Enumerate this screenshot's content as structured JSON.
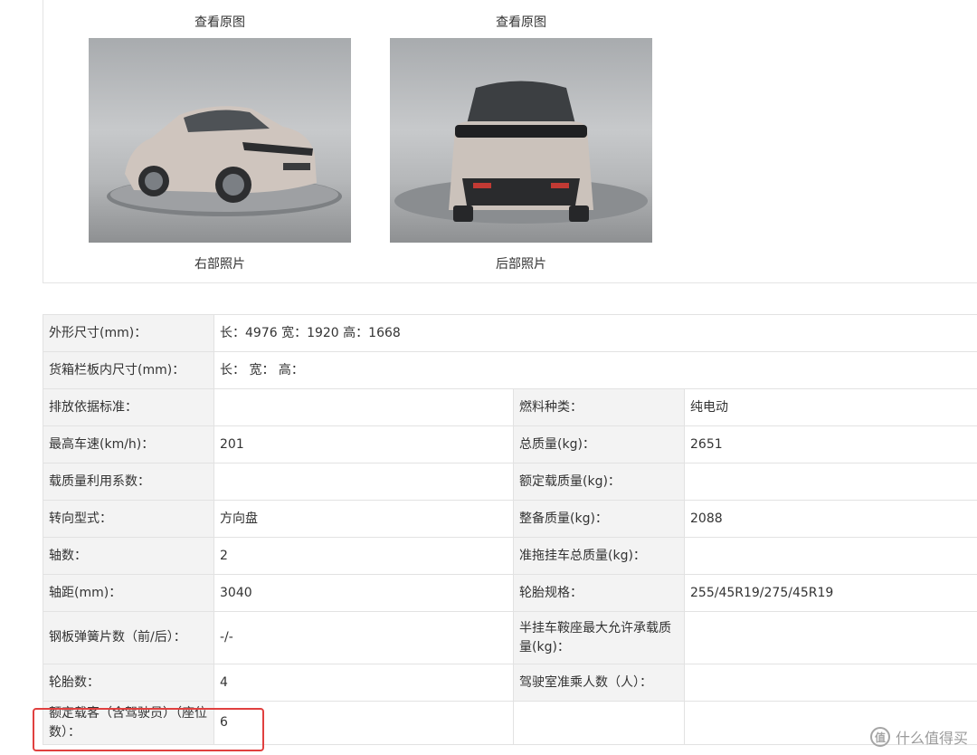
{
  "photos": [
    {
      "link": "查看原图",
      "caption": "右部照片",
      "icon": "car-front-right-photo"
    },
    {
      "link": "查看原图",
      "caption": "后部照片",
      "icon": "car-rear-photo"
    }
  ],
  "specs": {
    "dimensions_label": "外形尺寸(mm)：",
    "dimensions_value": "长：4976 宽：1920 高：1668",
    "cargo_label": "货箱栏板内尺寸(mm)：",
    "cargo_value": "长：  宽：  高：",
    "rows": [
      {
        "l1": "排放依据标准：",
        "v1": "",
        "l2": "燃料种类：",
        "v2": "纯电动"
      },
      {
        "l1": "最高车速(km/h)：",
        "v1": "201",
        "l2": "总质量(kg)：",
        "v2": "2651"
      },
      {
        "l1": "载质量利用系数：",
        "v1": "",
        "l2": "额定载质量(kg)：",
        "v2": ""
      },
      {
        "l1": "转向型式：",
        "v1": "方向盘",
        "l2": "整备质量(kg)：",
        "v2": "2088"
      },
      {
        "l1": "轴数：",
        "v1": "2",
        "l2": "准拖挂车总质量(kg)：",
        "v2": ""
      },
      {
        "l1": "轴距(mm)：",
        "v1": "3040",
        "l2": "轮胎规格：",
        "v2": "255/45R19/275/45R19"
      },
      {
        "l1": "钢板弹簧片数（前/后）：",
        "v1": "-/-",
        "l2": "半挂车鞍座最大允许承载质量(kg)：",
        "v2": ""
      },
      {
        "l1": "轮胎数：",
        "v1": "4",
        "l2": "驾驶室准乘人数（人）：",
        "v2": ""
      },
      {
        "l1": "额定载客（含驾驶员）（座位数）：",
        "v1": "6",
        "l2": "",
        "v2": ""
      }
    ]
  },
  "watermark": {
    "icon": "value-logo-icon",
    "icon_char": "值",
    "text": "什么值得买"
  },
  "colors": {
    "highlight": "#e0403f",
    "label_bg": "#f3f3f3",
    "border": "#e2e2e2"
  }
}
